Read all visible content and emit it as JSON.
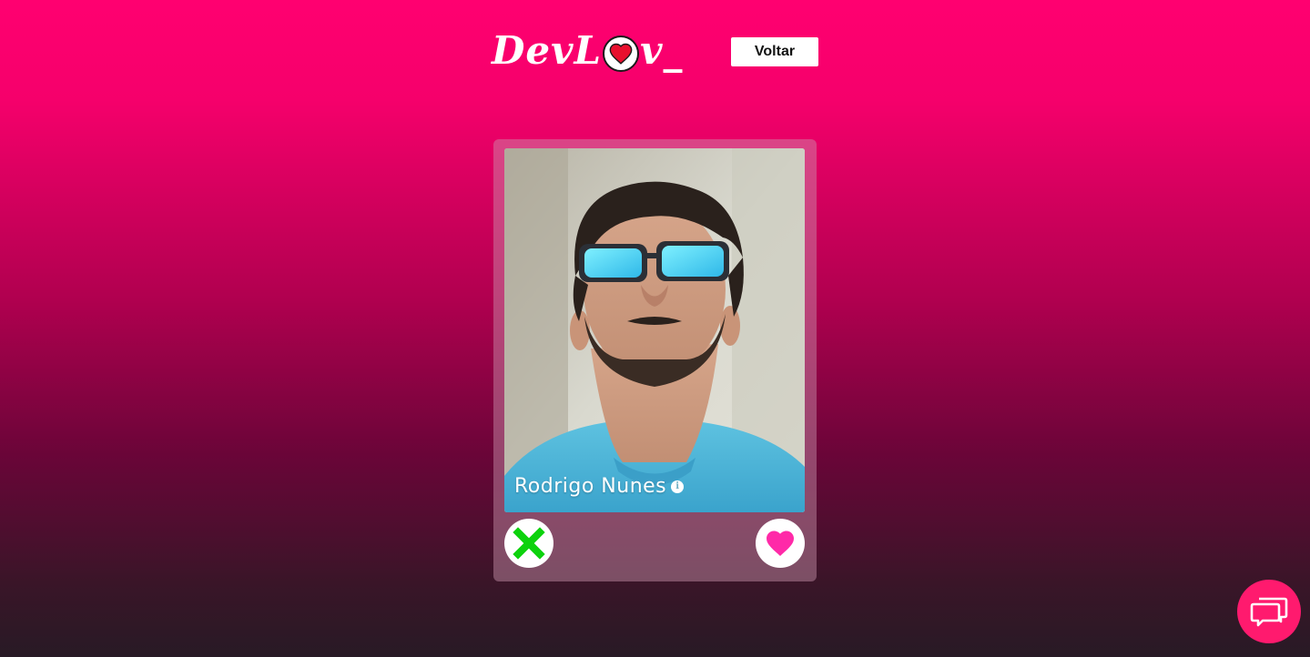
{
  "header": {
    "logo_prefix": "DevL",
    "logo_suffix": "v_",
    "back_label": "Voltar"
  },
  "card": {
    "name": "Rodrigo Nunes",
    "info_glyph": "i"
  },
  "icons": {
    "logo_heart": "heart-icon",
    "dislike": "close-icon",
    "like": "heart-icon",
    "chat": "chat-bubbles-icon",
    "info": "info-icon"
  },
  "colors": {
    "brand_pink": "#ff0070",
    "like_pink": "#ff2aa8",
    "dislike_green": "#0dd20d",
    "chat_pink": "#ff1a6e"
  }
}
